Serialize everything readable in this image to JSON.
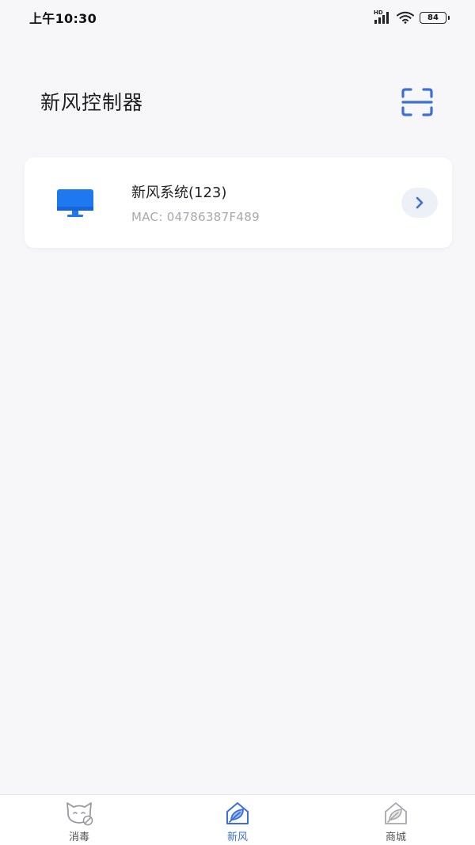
{
  "status_bar": {
    "time": "上午10:30",
    "network_label": "HD",
    "battery": "84"
  },
  "header": {
    "title": "新风控制器"
  },
  "device": {
    "name": "新风系统(123)",
    "mac": "MAC: 04786387F489"
  },
  "tabs": [
    {
      "label": "消毒",
      "icon": "cat-disinfect-icon",
      "active": false
    },
    {
      "label": "新风",
      "icon": "leaf-house-icon",
      "active": true
    },
    {
      "label": "商城",
      "icon": "leaf-house-icon",
      "active": false
    }
  ],
  "colors": {
    "accent": "#3b6fd9",
    "device_icon": "#1e78f0",
    "background": "#f7f7f9",
    "muted_text": "#a8a8ad"
  }
}
